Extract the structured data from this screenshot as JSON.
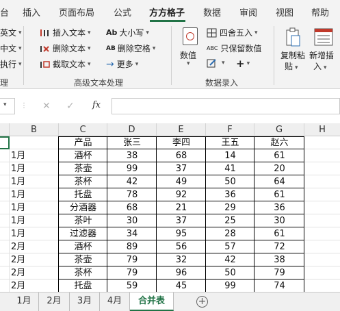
{
  "ribbon_tabs": [
    "台",
    "插入",
    "页面布局",
    "公式",
    "方方格子",
    "数据",
    "审阅",
    "视图",
    "帮助"
  ],
  "active_tab": "方方格子",
  "ribbon": {
    "left_partial": [
      "英文",
      "中文",
      "执行",
      "理"
    ],
    "text_group": {
      "insert_text": "插入文本",
      "delete_text": "删除文本",
      "extract_text": "截取文本",
      "case": "大小写",
      "delete_space": "删除空格",
      "more": "更多",
      "case_icon": "Ab",
      "space_icon": "AB",
      "label": "高级文本处理"
    },
    "number_group": {
      "value_button": "数值",
      "round": "四舍五入",
      "keep_value": "只保留数值",
      "keep_icon": "ABC",
      "label": "数据录入"
    },
    "copy_paste": [
      "复制粘",
      "贴"
    ],
    "new_insert": [
      "新增插",
      "入"
    ]
  },
  "formula_bar": {
    "cancel": "✕",
    "confirm": "✓",
    "fx": "fx",
    "value": ""
  },
  "column_headers": [
    "B",
    "C",
    "D",
    "E",
    "F",
    "G",
    "H"
  ],
  "table": {
    "headers": [
      "产品",
      "张三",
      "李四",
      "王五",
      "赵六"
    ],
    "rows": [
      [
        "1月",
        "酒杯",
        "38",
        "68",
        "14",
        "61"
      ],
      [
        "1月",
        "茶壶",
        "99",
        "37",
        "41",
        "20"
      ],
      [
        "1月",
        "茶杯",
        "42",
        "49",
        "50",
        "64"
      ],
      [
        "1月",
        "托盘",
        "78",
        "92",
        "36",
        "61"
      ],
      [
        "1月",
        "分酒器",
        "68",
        "21",
        "29",
        "36"
      ],
      [
        "1月",
        "茶叶",
        "30",
        "37",
        "25",
        "30"
      ],
      [
        "1月",
        "过滤器",
        "34",
        "95",
        "28",
        "61"
      ],
      [
        "2月",
        "酒杯",
        "89",
        "56",
        "57",
        "72"
      ],
      [
        "2月",
        "茶壶",
        "79",
        "32",
        "42",
        "38"
      ],
      [
        "2月",
        "茶杯",
        "79",
        "96",
        "50",
        "79"
      ],
      [
        "2月",
        "托盘",
        "59",
        "45",
        "99",
        "74"
      ]
    ]
  },
  "sheet_tabs": [
    "1月",
    "2月",
    "3月",
    "4月",
    "合并表"
  ],
  "active_sheet": "合并表",
  "colors": {
    "accent": "#217346",
    "ribbon_bg": "#f3f3f3",
    "header_bg": "#efefef"
  }
}
